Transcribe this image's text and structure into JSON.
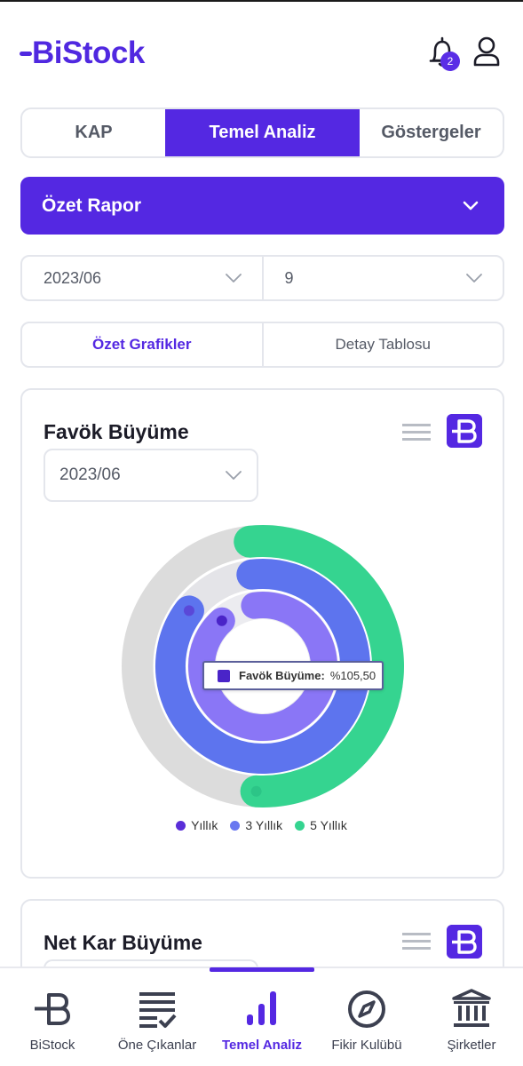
{
  "header": {
    "logo_text": "BiStock",
    "notification_count": "2"
  },
  "tabs": [
    {
      "label": "KAP",
      "active": false
    },
    {
      "label": "Temel Analiz",
      "active": true
    },
    {
      "label": "Göstergeler",
      "active": false
    }
  ],
  "report_dropdown": {
    "label": "Özet Rapor"
  },
  "period": {
    "date": "2023/06",
    "count": "9"
  },
  "subtabs": [
    {
      "label": "Özet Grafikler",
      "active": true
    },
    {
      "label": "Detay Tablosu",
      "active": false
    }
  ],
  "cards": [
    {
      "title": "Favök Büyüme",
      "year": "2023/06"
    },
    {
      "title": "Net Kar Büyüme",
      "year": ""
    }
  ],
  "chart_data": {
    "type": "radialBar",
    "title": "Favök Büyüme",
    "series": [
      {
        "name": "Yıllık",
        "color": "#5a2ed8"
      },
      {
        "name": "3 Yıllık",
        "color": "#6a78f0"
      },
      {
        "name": "5 Yıllık",
        "color": "#35d490"
      }
    ],
    "tooltip": {
      "label": "Favök Büyüme:",
      "value": "%105,50"
    }
  },
  "colors": {
    "brand": "#5428e2",
    "ring_track": "#dcdcdc",
    "green": "#35d490"
  },
  "bottom_nav": [
    {
      "label": "BiStock",
      "icon": "bistock-icon",
      "active": false
    },
    {
      "label": "Öne Çıkanlar",
      "icon": "list-check-icon",
      "active": false
    },
    {
      "label": "Temel Analiz",
      "icon": "bar-chart-icon",
      "active": true
    },
    {
      "label": "Fikir Kulübü",
      "icon": "compass-icon",
      "active": false
    },
    {
      "label": "Şirketler",
      "icon": "bank-icon",
      "active": false
    }
  ]
}
